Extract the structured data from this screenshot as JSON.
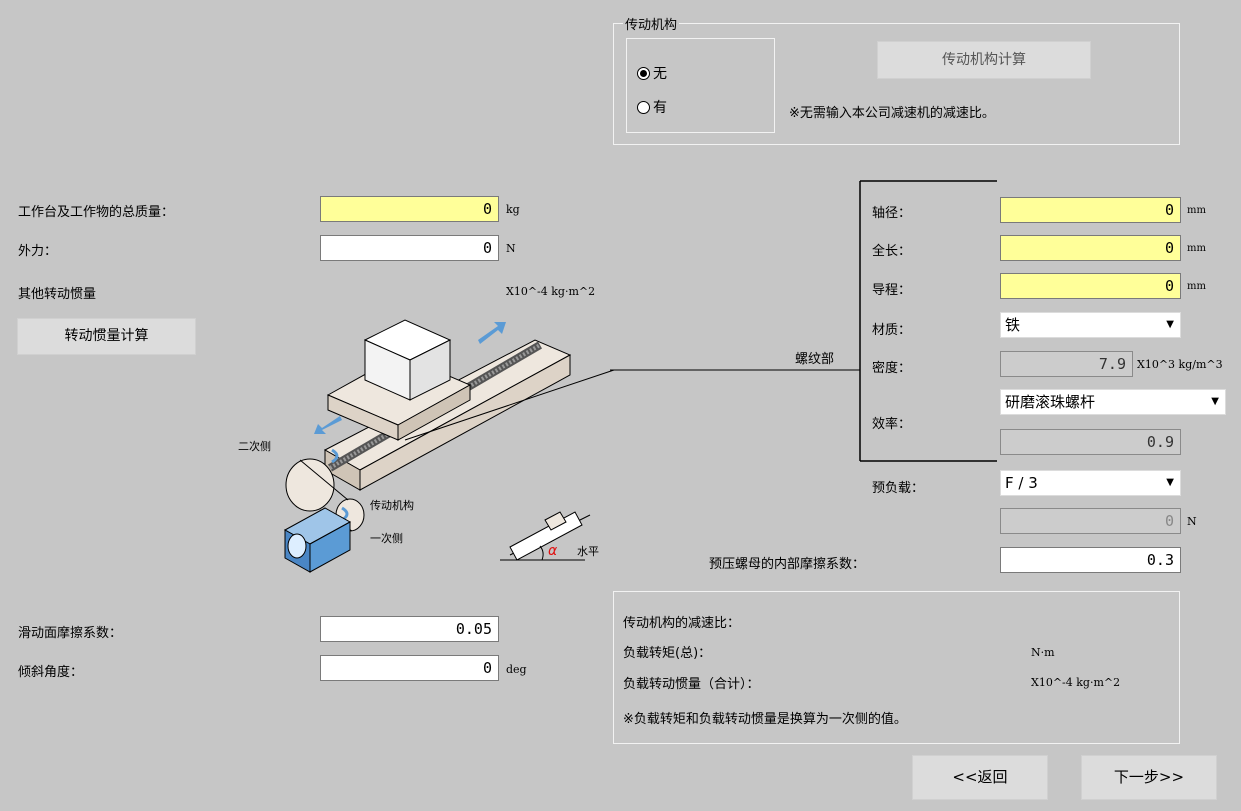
{
  "mechanism": {
    "group_title": "传动机构",
    "options": [
      {
        "label": "无",
        "selected": true
      },
      {
        "label": "有",
        "selected": false
      }
    ],
    "calc_button": "传动机构计算",
    "note": "※无需输入本公司减速机的减速比。"
  },
  "left": {
    "total_mass": {
      "label": "工作台及工作物的总质量：",
      "value": "0",
      "unit": "kg"
    },
    "external_force": {
      "label": "外力：",
      "value": "0",
      "unit": "N"
    },
    "other_inertia": {
      "label": "其他转动惯量",
      "unit": "X10^-4 kg·m^2"
    },
    "inertia_calc_button": "转动惯量计算",
    "friction": {
      "label": "滑动面摩擦系数：",
      "value": "0.05"
    },
    "incline": {
      "label": "倾斜角度：",
      "value": "0",
      "unit": "deg"
    }
  },
  "diagram": {
    "secondary_side": "二次侧",
    "mechanism_label": "传动机构",
    "primary_side": "一次侧",
    "horizontal": "水平",
    "alpha": "α",
    "screw_part": "螺纹部"
  },
  "screw": {
    "diameter": {
      "label": "轴径：",
      "value": "0",
      "unit": "mm"
    },
    "length": {
      "label": "全长：",
      "value": "0",
      "unit": "mm"
    },
    "lead": {
      "label": "导程：",
      "value": "0",
      "unit": "mm"
    },
    "material": {
      "label": "材质：",
      "value": "铁"
    },
    "density": {
      "label": "密度：",
      "value": "7.9",
      "unit": "X10^3 kg/m^3"
    },
    "efficiency": {
      "label": "效率：",
      "type": "研磨滚珠螺杆",
      "value": "0.9"
    },
    "preload": {
      "label": "预负载：",
      "value": "F / 3",
      "force_value": "0",
      "unit": "N"
    },
    "nut_friction": {
      "label": "预压螺母的内部摩擦系数：",
      "value": "0.3"
    }
  },
  "results": {
    "reduction_ratio": "传动机构的减速比：",
    "load_torque": {
      "label": "负载转矩(总)：",
      "unit": "N·m"
    },
    "load_inertia": {
      "label": "负载转动惯量（合计）：",
      "unit": "X10^-4 kg·m^2"
    },
    "note": "※负载转矩和负载转动惯量是换算为一次侧的值。"
  },
  "nav": {
    "back": "<<返回",
    "next": "下一步>>"
  },
  "colors": {
    "background": "#c6c6c6",
    "required_field": "#ffff99",
    "arrow_blue": "#5b9bd5"
  }
}
